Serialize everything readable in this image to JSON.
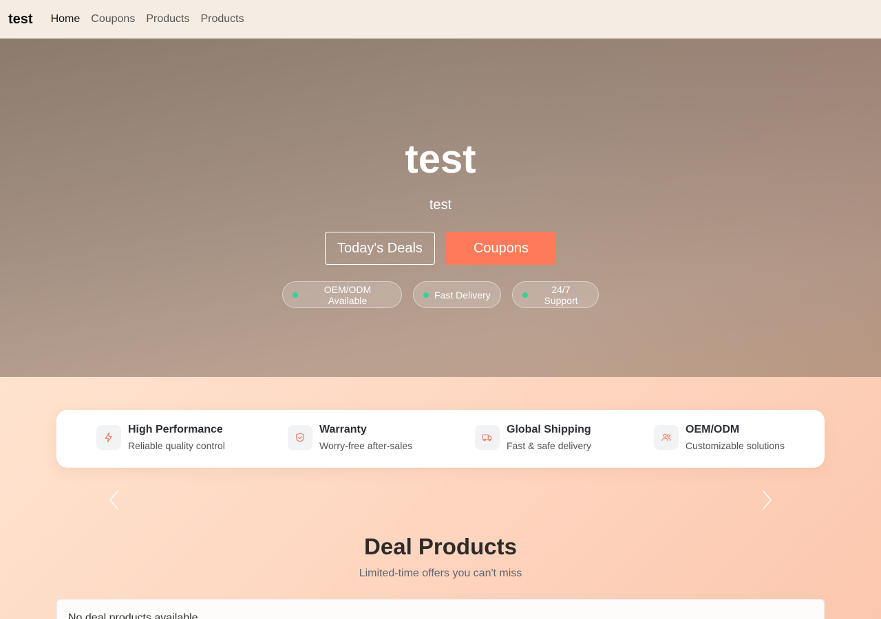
{
  "nav": {
    "brand": "test",
    "links": [
      "Home",
      "Coupons",
      "Products",
      "Products"
    ]
  },
  "hero": {
    "title": "test",
    "subtitle": "test",
    "buttons": {
      "deals": "Today's Deals",
      "coupons": "Coupons"
    },
    "pills": [
      "OEM/ODM Available",
      "Fast Delivery",
      "24/7 Support"
    ]
  },
  "features": [
    {
      "title": "High Performance",
      "desc": "Reliable quality control",
      "icon": "lightning-icon"
    },
    {
      "title": "Warranty",
      "desc": "Worry-free after-sales",
      "icon": "shield-check-icon"
    },
    {
      "title": "Global Shipping",
      "desc": "Fast & safe delivery",
      "icon": "truck-icon"
    },
    {
      "title": "OEM/ODM",
      "desc": "Customizable solutions",
      "icon": "users-icon"
    }
  ],
  "deals": {
    "title": "Deal Products",
    "subtitle": "Limited-time offers you can't miss",
    "empty": "No deal products available"
  },
  "colors": {
    "accent": "#fe7a5b",
    "status_dot": "#34d399"
  }
}
